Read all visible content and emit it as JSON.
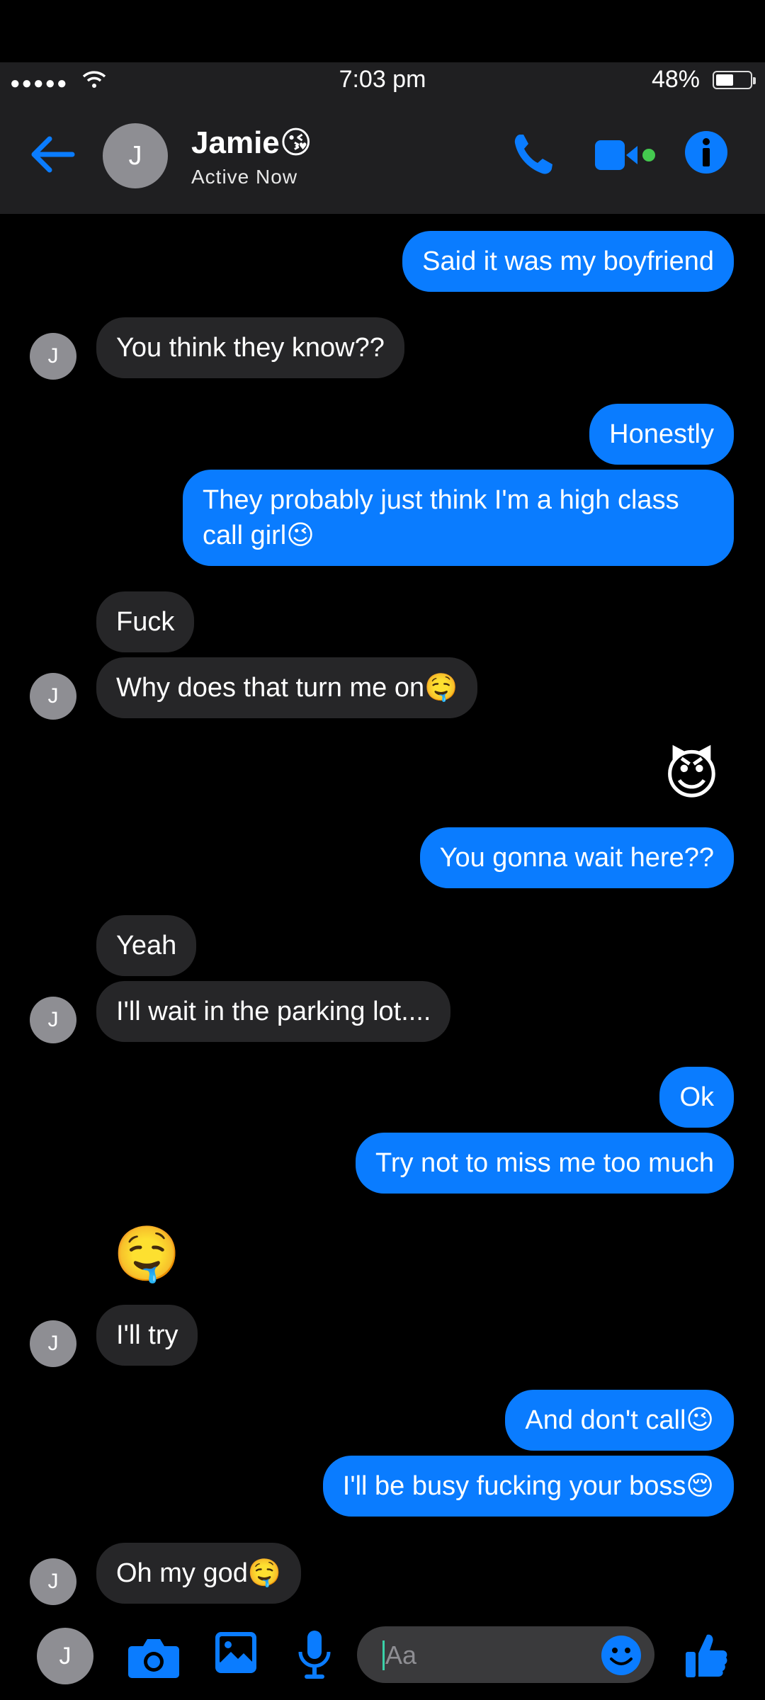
{
  "status": {
    "time": "7:03 pm",
    "battery_pct": "48%",
    "battery_level": 0.48
  },
  "header": {
    "avatar_initial": "J",
    "name": "Jamie😘",
    "subtitle": "Active Now",
    "colors": {
      "accent": "#0a7cff",
      "video_online": "#44c94f"
    }
  },
  "messages": [
    {
      "from": "me",
      "text": "Said it was my boyfriend"
    },
    {
      "from": "them",
      "text": "You think they know??",
      "avatar": "J"
    },
    {
      "from": "me",
      "text": "Honestly"
    },
    {
      "from": "me",
      "text": "They probably just think I'm a high class call girl😉"
    },
    {
      "from": "them",
      "text": "Fuck"
    },
    {
      "from": "them",
      "text": "Why does that turn me on🤤",
      "avatar": "J"
    },
    {
      "from": "me",
      "text": "😈"
    },
    {
      "from": "me",
      "text": "You gonna wait here??"
    },
    {
      "from": "them",
      "text": "Yeah"
    },
    {
      "from": "them",
      "text": "I'll wait in the parking lot....",
      "avatar": "J"
    },
    {
      "from": "me",
      "text": "Ok"
    },
    {
      "from": "me",
      "text": "Try not to miss me too much"
    },
    {
      "from": "them",
      "text": "🤤"
    },
    {
      "from": "them",
      "text": "I'll try",
      "avatar": "J"
    },
    {
      "from": "me",
      "text": "And don't call😉"
    },
    {
      "from": "me",
      "text": "I'll be busy fucking your boss😌"
    },
    {
      "from": "them",
      "text": "Oh my god🤤",
      "avatar": "J"
    }
  ],
  "composer": {
    "avatar_initial": "J",
    "placeholder": "Aa"
  }
}
